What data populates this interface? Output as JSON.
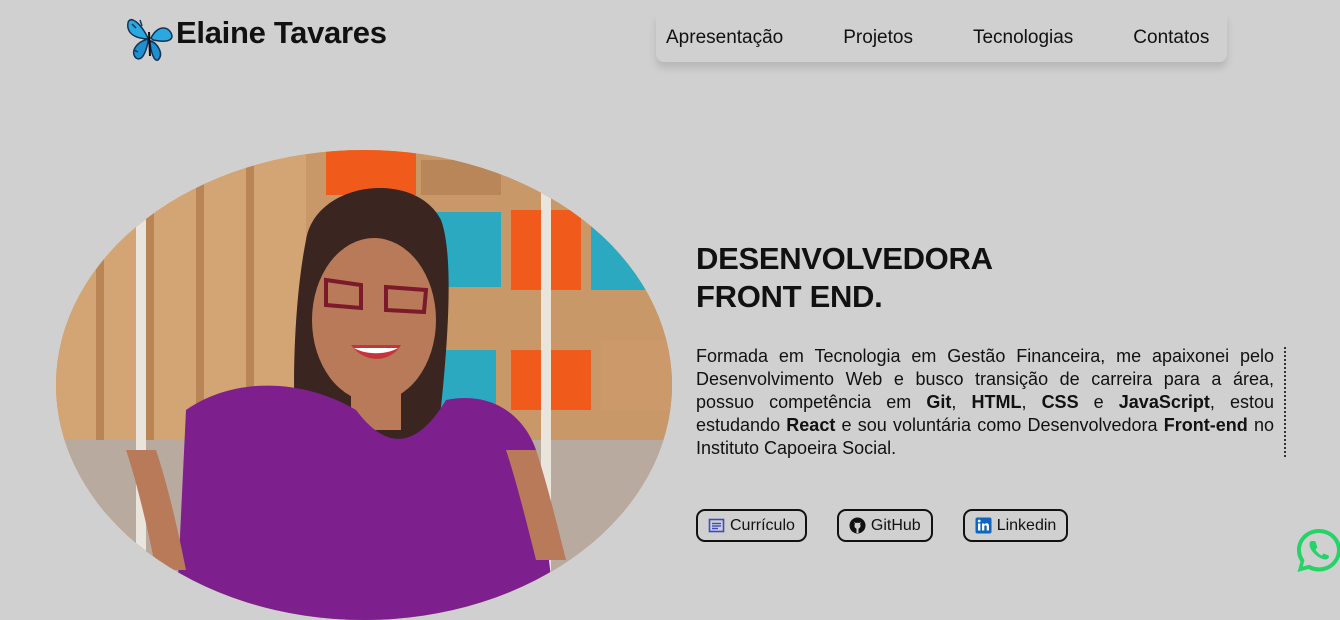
{
  "brand": {
    "name": "Elaine Tavares",
    "logo_icon": "butterfly-icon"
  },
  "nav": {
    "items": [
      "Apresentação",
      "Projetos",
      "Tecnologias",
      "Contatos"
    ]
  },
  "hero": {
    "headline_line1": "DESENVOLVEDORA",
    "headline_line2": "FRONT END.",
    "bio": {
      "p1": "Formada em Tecnologia em Gestão Financeira, me apaixonei pelo Desenvolvimento Web e busco transição de carreira para a área, possuo competência em ",
      "git": "Git",
      "sep1": ", ",
      "html": "HTML",
      "sep2": ", ",
      "css": "CSS",
      "sep3": " e ",
      "js": "JavaScript",
      "p2": ", estou estudando ",
      "react": "React",
      "p3": " e sou voluntária como Desenvolvedora ",
      "frontend": "Front-end",
      "p4": " no Instituto Capoeira Social."
    },
    "buttons": {
      "curriculo": "Currículo",
      "github": "GitHub",
      "linkedin": "Linkedin"
    }
  },
  "colors": {
    "background": "#d0d0d0",
    "whatsapp": "#25d366",
    "linkedin": "#0a66c2",
    "curriculo_icon": "#3b4bc8"
  }
}
